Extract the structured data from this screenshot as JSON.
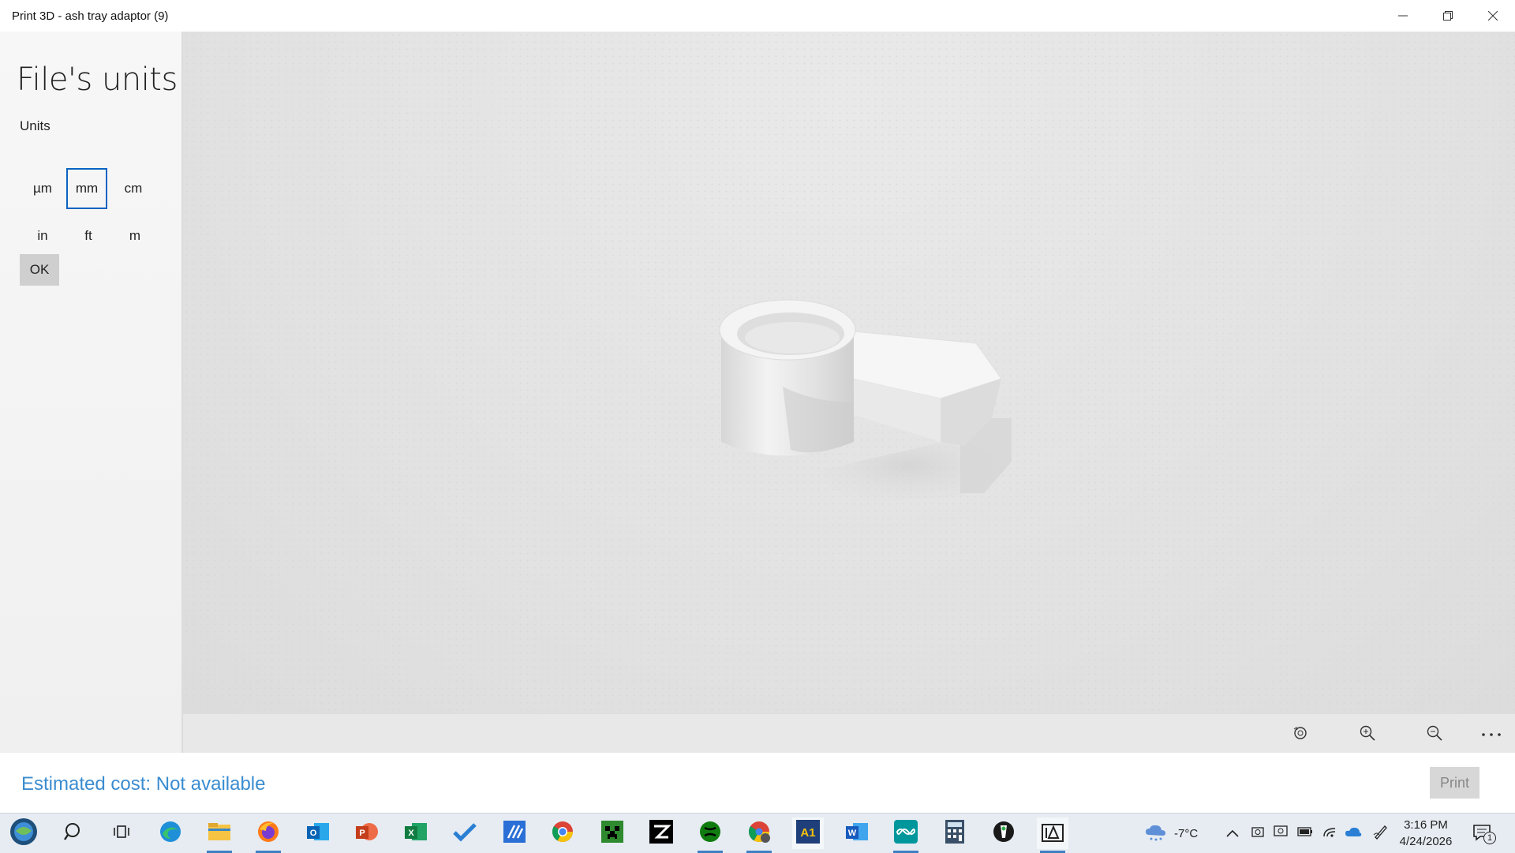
{
  "window": {
    "title": "Print 3D - ash tray adaptor (9)",
    "controls": [
      "minimize-icon",
      "restore-icon",
      "close-icon"
    ]
  },
  "panel": {
    "heading": "File's units",
    "units_label": "Units",
    "units": [
      {
        "label": "µm",
        "selected": false
      },
      {
        "label": "mm",
        "selected": true
      },
      {
        "label": "cm",
        "selected": false
      },
      {
        "label": "in",
        "selected": false
      },
      {
        "label": "ft",
        "selected": false
      },
      {
        "label": "m",
        "selected": false
      }
    ],
    "ok_label": "OK",
    "selection_color": "#0a63c2"
  },
  "viewport": {
    "model": "ash tray adaptor (9)",
    "toolbar": [
      "reset-view-icon",
      "zoom-in-icon",
      "zoom-out-icon",
      "more-options-icon"
    ]
  },
  "footer": {
    "cost_text": "Estimated cost: Not available",
    "print_label": "Print",
    "cost_color": "#3a8cd0"
  },
  "taskbar": {
    "apps": [
      "start-icon",
      "search-icon",
      "task-view-icon",
      "edge-icon",
      "file-explorer-icon",
      "firefox-icon",
      "outlook-icon",
      "powerpoint-icon",
      "excel-icon",
      "todo-icon",
      "app-icon",
      "chrome-icon",
      "minecraft-icon",
      "capcut-icon",
      "xbox-icon",
      "chrome-profile-icon",
      "a1-icon",
      "word-icon",
      "arduino-icon",
      "calculator-icon",
      "app-icon-2",
      "print3d-icon"
    ],
    "weather": "-7°C",
    "time": "3:16 PM",
    "date": "4/24/2026",
    "notification_count": "1"
  }
}
